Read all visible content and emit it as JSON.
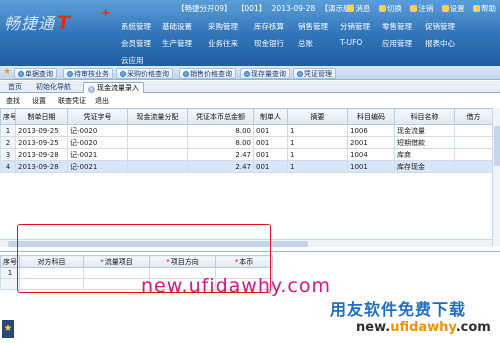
{
  "brand": {
    "logo_text": "畅捷通",
    "logo_mark": "T",
    "logo_plus": "+"
  },
  "infobar": {
    "account": "【畅捷分开09】",
    "code": "【001】",
    "date": "2013-09-28",
    "mode": "【演示版】",
    "message_label": "消息",
    "switch_label": "切换",
    "logout_label": "注销",
    "settings_label": "设置",
    "help_label": "帮助"
  },
  "top_menu": [
    "系统管理",
    "基础设置",
    "采购管理",
    "库存核算",
    "销售管理",
    "分销管理",
    "零售管理",
    "促销管理",
    "会员管理",
    "生产管理",
    "业务往来",
    "现金银行",
    "总账",
    "T-UFO",
    "应用管理",
    "报表中心",
    "云应用"
  ],
  "nav_tabs": [
    "单据查询",
    "待审核业务",
    "采购价格查询",
    "销售价格查询",
    "现存量查询",
    "凭证管理"
  ],
  "page_tabs": {
    "home": "首页",
    "init": "初始化导航",
    "active": "现金流量录入"
  },
  "toolbar": [
    "查找",
    "设置",
    "联查凭证",
    "退出"
  ],
  "grid": {
    "columns": [
      "序号",
      "制单日期",
      "凭证字号",
      "现金流量分配",
      "凭证本币总金额",
      "制单人",
      "摘要",
      "科目编码",
      "科目名称",
      "借方"
    ],
    "rows": [
      [
        "1",
        "2013-09-25",
        "记-0020",
        "",
        "8.00",
        "001",
        "1",
        "1006",
        "现金流量",
        ""
      ],
      [
        "2",
        "2013-09-25",
        "记-0020",
        "",
        "8.00",
        "001",
        "1",
        "2001",
        "短期借款",
        ""
      ],
      [
        "3",
        "2013-09-28",
        "记-0021",
        "",
        "2.47",
        "001",
        "1",
        "1004",
        "库商",
        ""
      ],
      [
        "4",
        "2013-09-28",
        "记-0021",
        "",
        "2.47",
        "001",
        "1",
        "1001",
        "库存现金",
        ""
      ]
    ],
    "selected_row": 3
  },
  "lower_grid": {
    "columns": [
      {
        "label": "序号",
        "required": false
      },
      {
        "label": "对方科目",
        "required": false
      },
      {
        "label": "流量项目",
        "required": true
      },
      {
        "label": "项目方向",
        "required": true
      },
      {
        "label": "本币",
        "required": true
      }
    ],
    "rows": [
      [
        "1",
        "",
        "",
        "",
        ""
      ]
    ]
  },
  "watermark": {
    "url": "new.ufidawhy.com",
    "cn": "用友软件免费下载",
    "url2_a": "new.",
    "url2_b": "ufidawhy",
    "url2_c": ".com"
  },
  "colors": {
    "header_blue": "#2f73b8",
    "highlight_row": "#d8e7f8",
    "red_box": "#e3141c",
    "watermark_pink": "#d9138a"
  }
}
